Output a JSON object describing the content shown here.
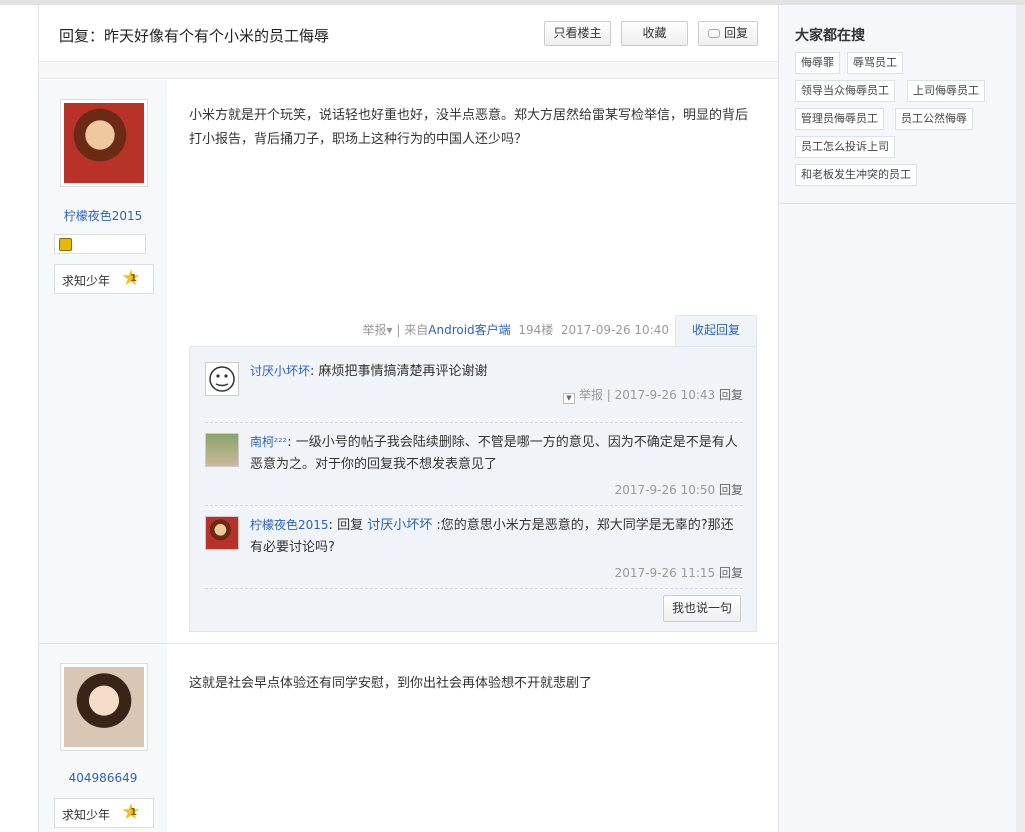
{
  "header": {
    "title": "回复：昨天好像有个有个小米的员工侮辱",
    "btn_only_op": "只看楼主",
    "btn_fav": "收藏",
    "btn_reply": "回复"
  },
  "post1": {
    "username": "柠檬夜色2015",
    "rank_label": "求知少年",
    "rank_level": "1",
    "content": "小米方就是开个玩笑，说话轻也好重也好，没半点恶意。郑大方居然给雷某写检举信，明显的背后打小报告，背后捅刀子，职场上这种行为的中国人还少吗？",
    "report": "举报",
    "report_arrow": "▾",
    "divider": "|",
    "from_prefix": "来自",
    "client": "Android客户端",
    "floor": "194楼",
    "time": "2017-09-26 10:40",
    "collapse": "收起回复",
    "comments": [
      {
        "user": "讨厌小坏坏",
        "sep": ": ",
        "text": "麻烦把事情搞清楚再评论谢谢",
        "report": "举报",
        "divider": "|",
        "time": "2017-9-26 10:43",
        "reply": "回复"
      },
      {
        "user": "南柯ᶻᶻᶻ",
        "sep": ": ",
        "text": "一级小号的帖子我会陆续删除、不管是哪一方的意见、因为不确定是不是有人恶意为之。对于你的回复我不想发表意见了",
        "time": "2017-9-26 10:50",
        "reply": "回复"
      },
      {
        "user": "柠檬夜色2015",
        "sep": ": ",
        "reply_word": "回复 ",
        "reply_to": "讨厌小坏坏",
        "text": " :您的意思小米方是恶意的，郑大同学是无辜的?那还有必要讨论吗?",
        "time": "2017-9-26 11:15",
        "reply": "回复"
      }
    ],
    "say_btn": "我也说一句"
  },
  "post2": {
    "username": "404986649",
    "rank_label": "求知少年",
    "rank_level": "1",
    "content": "这就是社会早点体验还有同学安慰，到你出社会再体验想不开就悲剧了"
  },
  "sidebar": {
    "title": "大家都在搜",
    "tags": [
      "侮辱罪",
      "辱骂员工",
      "领导当众侮辱员工",
      "上司侮辱员工",
      "管理员侮辱员工",
      "员工公然侮辱",
      "员工怎么投诉上司",
      "和老板发生冲突的员工"
    ]
  },
  "colors": {
    "link": "#2d64b3",
    "sidebar_bg": "#f5f7fa",
    "comment_bg": "#f0f3f7",
    "star": "#f4c21b"
  }
}
